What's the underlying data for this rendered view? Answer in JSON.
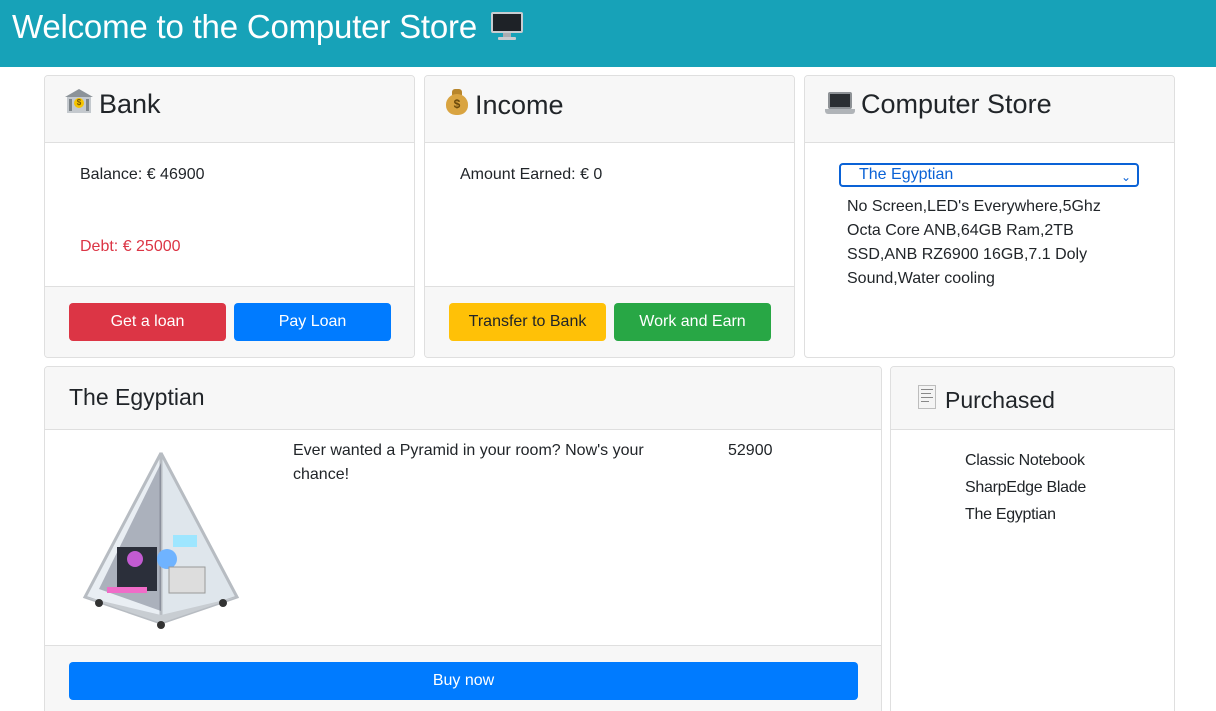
{
  "header": {
    "title": "Welcome to the Computer Store",
    "icon": "desktop-computer-icon"
  },
  "bank": {
    "title": "Bank",
    "icon": "bank-icon",
    "balance_text": "Balance: € 46900",
    "debt_text": "Debt: € 25000",
    "get_loan_label": "Get a loan",
    "pay_loan_label": "Pay Loan"
  },
  "income": {
    "title": "Income",
    "icon": "money-bag-icon",
    "amount_text": "Amount Earned: € 0",
    "transfer_label": "Transfer to Bank",
    "work_label": "Work and Earn"
  },
  "store": {
    "title": "Computer Store",
    "icon": "laptop-icon",
    "selected": "The Egyptian",
    "features": "No Screen,LED's Everywhere,5Ghz Octa Core ANB,64GB Ram,2TB SSD,ANB RZ6900 16GB,7.1 Doly Sound,Water cooling"
  },
  "product": {
    "name": "The Egyptian",
    "description": "Ever wanted a Pyramid in your room? Now's your chance!",
    "price": "52900",
    "buy_label": "Buy now"
  },
  "purchased": {
    "title": "Purchased",
    "icon": "receipt-icon",
    "items": [
      "Classic Notebook",
      "SharpEdge Blade",
      "The Egyptian"
    ]
  },
  "colors": {
    "header_bg": "#17a2b8",
    "danger": "#dc3545",
    "primary": "#007bff",
    "warning": "#ffc107",
    "success": "#28a745"
  }
}
